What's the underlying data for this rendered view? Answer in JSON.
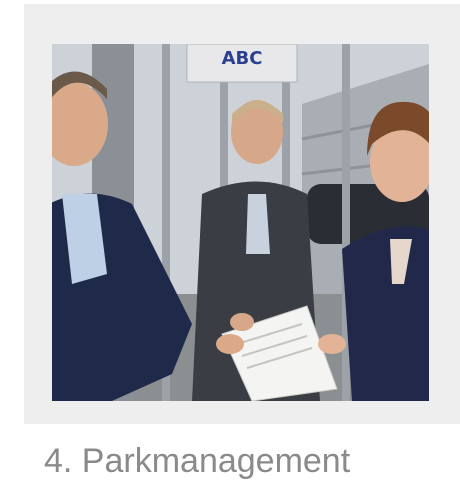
{
  "card": {
    "caption": "4. Parkmanagement"
  },
  "photo": {
    "sign_label": "ABC"
  },
  "colors": {
    "tile_background": "#eeeeee",
    "caption_text": "#8a8a8a",
    "suit_navy": "#1f2a4a",
    "suit_grey": "#3a3d44"
  }
}
